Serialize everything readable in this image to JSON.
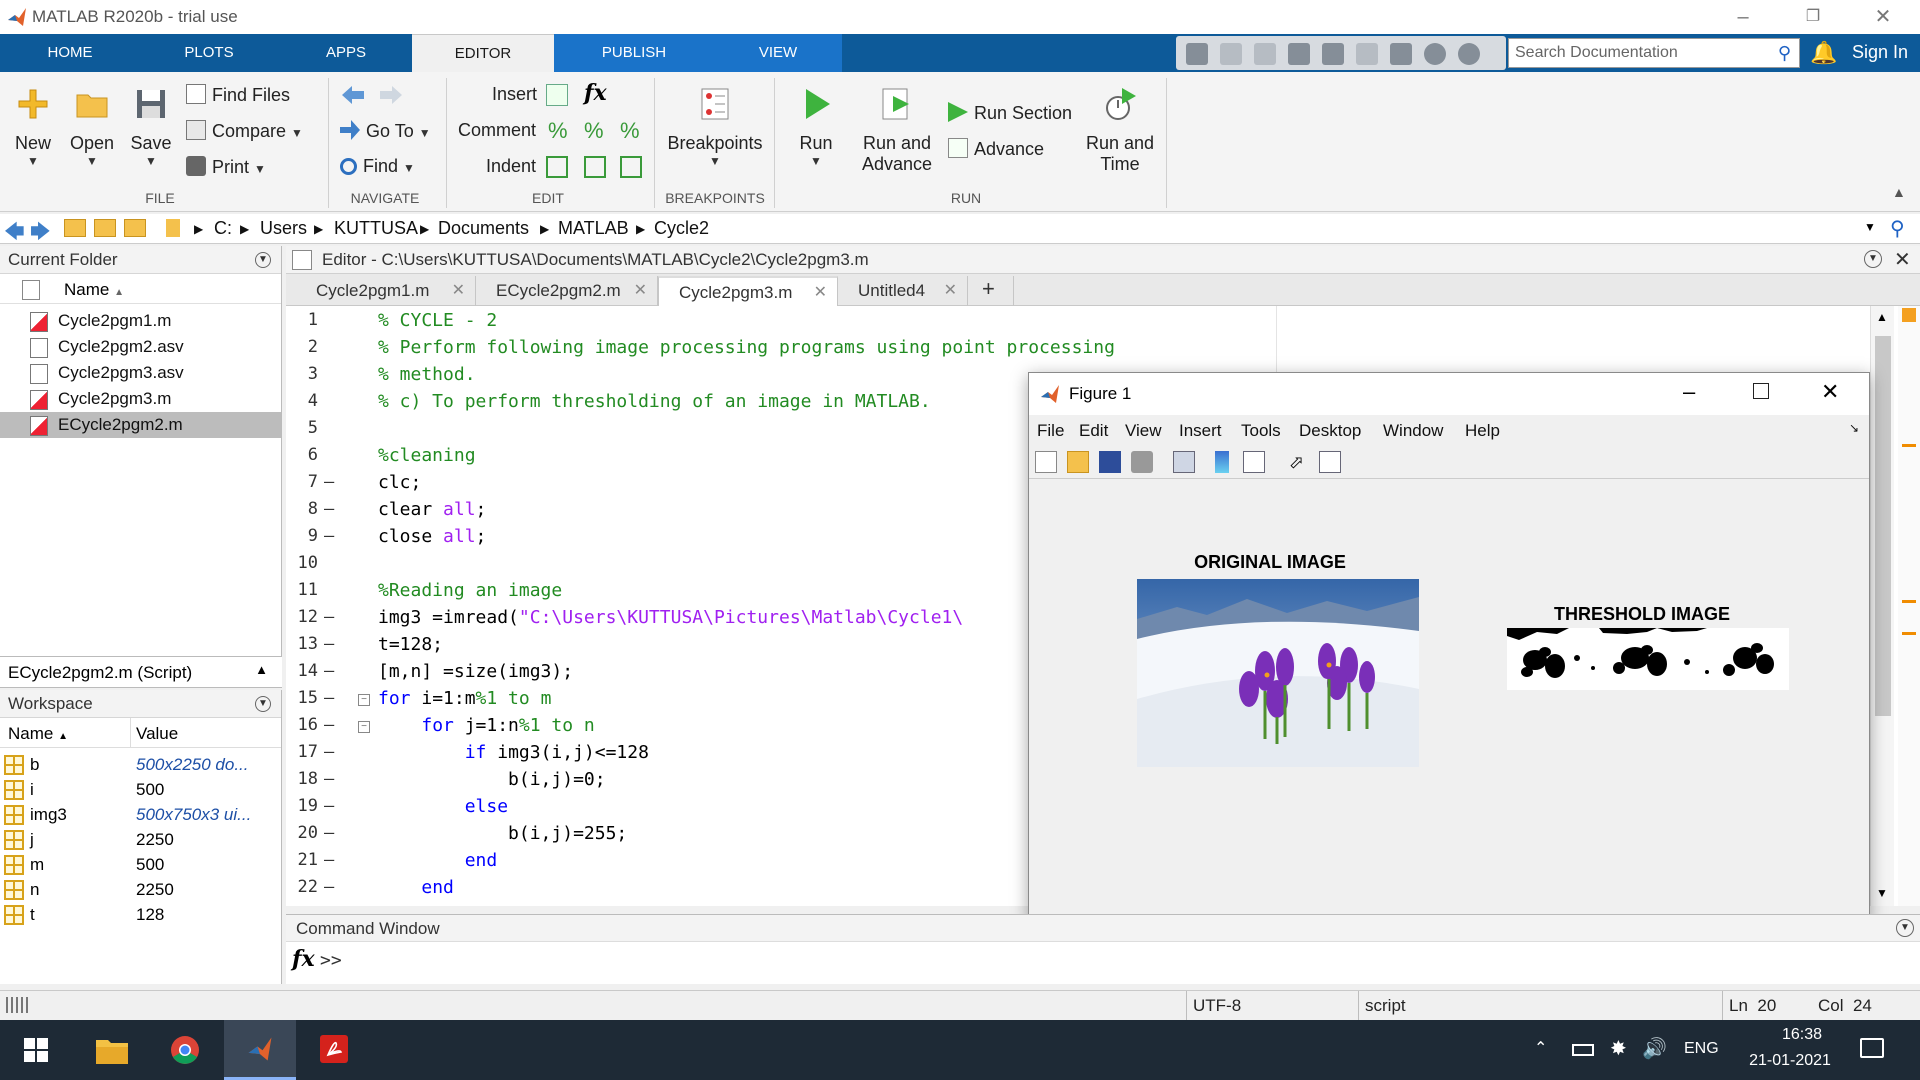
{
  "window": {
    "title": "MATLAB R2020b - trial use"
  },
  "ribbon_tabs": [
    "HOME",
    "PLOTS",
    "APPS",
    "EDITOR",
    "PUBLISH",
    "VIEW"
  ],
  "search": {
    "placeholder": "Search Documentation"
  },
  "signin": "Sign In",
  "ribbon": {
    "file": {
      "new": "New",
      "open": "Open",
      "save": "Save",
      "find_files": "Find Files",
      "compare": "Compare",
      "print": "Print",
      "label": "FILE"
    },
    "navigate": {
      "goto": "Go To",
      "find": "Find",
      "label": "NAVIGATE"
    },
    "edit": {
      "insert": "Insert",
      "comment": "Comment",
      "indent": "Indent",
      "label": "EDIT"
    },
    "breakpoints": {
      "breakpoints": "Breakpoints",
      "label": "BREAKPOINTS"
    },
    "run": {
      "run": "Run",
      "run_and_advance_1": "Run and",
      "run_and_advance_2": "Advance",
      "run_section": "Run Section",
      "advance": "Advance",
      "run_and_time_1": "Run and",
      "run_and_time_2": "Time",
      "label": "RUN"
    }
  },
  "address": [
    "C:",
    "Users",
    "KUTTUSA",
    "Documents",
    "MATLAB",
    "Cycle2"
  ],
  "current_folder": {
    "title": "Current Folder",
    "col_name": "Name",
    "files": [
      {
        "name": "Cycle2pgm1.m",
        "type": "m"
      },
      {
        "name": "Cycle2pgm2.asv",
        "type": "asv"
      },
      {
        "name": "Cycle2pgm3.asv",
        "type": "asv"
      },
      {
        "name": "Cycle2pgm3.m",
        "type": "m"
      },
      {
        "name": "ECycle2pgm2.m",
        "type": "m"
      }
    ]
  },
  "details": "ECycle2pgm2.m  (Script)",
  "workspace": {
    "title": "Workspace",
    "col_name": "Name",
    "col_value": "Value",
    "vars": [
      {
        "name": "b",
        "value": "500x2250 do...",
        "italic": true
      },
      {
        "name": "i",
        "value": "500",
        "italic": false
      },
      {
        "name": "img3",
        "value": "500x750x3 ui...",
        "italic": true
      },
      {
        "name": "j",
        "value": "2250",
        "italic": false
      },
      {
        "name": "m",
        "value": "500",
        "italic": false
      },
      {
        "name": "n",
        "value": "2250",
        "italic": false
      },
      {
        "name": "t",
        "value": "128",
        "italic": false
      }
    ]
  },
  "editor": {
    "header": "Editor - C:\\Users\\KUTTUSA\\Documents\\MATLAB\\Cycle2\\Cycle2pgm3.m",
    "tabs": [
      "Cycle2pgm1.m",
      "ECycle2pgm2.m",
      "Cycle2pgm3.m",
      "Untitled4"
    ],
    "active_tab": 2,
    "lines": [
      "% CYCLE - 2",
      "% Perform following image processing programs using point processing",
      "% method.",
      "% c) To perform thresholding of an image in MATLAB.",
      "",
      "%cleaning",
      "clc;",
      "clear all;",
      "close all;",
      "",
      "%Reading an image",
      "img3 =imread(\"C:\\Users\\KUTTUSA\\Pictures\\Matlab\\Cycle1\\",
      "t=128;",
      "[m,n] =size(img3);",
      "for i=1:m%1 to m",
      "    for j=1:n%1 to n",
      "        if img3(i,j)<=128",
      "            b(i,j)=0;",
      "        else",
      "            b(i,j)=255;",
      "        end",
      "    end"
    ]
  },
  "figure": {
    "title": "Figure 1",
    "menu": [
      "File",
      "Edit",
      "View",
      "Insert",
      "Tools",
      "Desktop",
      "Window",
      "Help"
    ],
    "original_title": "ORIGINAL IMAGE",
    "threshold_title": "THRESHOLD IMAGE"
  },
  "command_window": {
    "title": "Command Window",
    "prompt": ">>"
  },
  "status": {
    "encoding": "UTF-8",
    "type": "script",
    "ln_label": "Ln",
    "ln": "20",
    "col_label": "Col",
    "col": "24"
  },
  "taskbar": {
    "lang": "ENG",
    "time": "16:38",
    "date": "21-01-2021"
  }
}
